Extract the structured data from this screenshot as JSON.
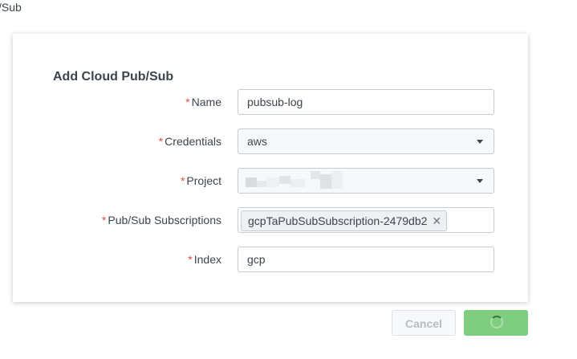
{
  "breadcrumb": "/Sub",
  "modal": {
    "title": "Add Cloud Pub/Sub",
    "required_marker": "*",
    "fields": {
      "name": {
        "label": "Name",
        "value": "pubsub-log"
      },
      "credentials": {
        "label": "Credentials",
        "value": "aws"
      },
      "project": {
        "label": "Project",
        "value": ""
      },
      "subscriptions": {
        "label": "Pub/Sub Subscriptions",
        "token": "gcpTaPubSubSubscription-2479db2"
      },
      "index": {
        "label": "Index",
        "value": "gcp"
      }
    }
  },
  "buttons": {
    "cancel_label": "Cancel",
    "submit_label": ""
  },
  "colors": {
    "required": "#dc4e41",
    "primary": "#7fce7f",
    "border": "#c3cbd4"
  },
  "icons": [
    "chevron-down-icon",
    "close-icon",
    "loading-spinner-icon"
  ]
}
